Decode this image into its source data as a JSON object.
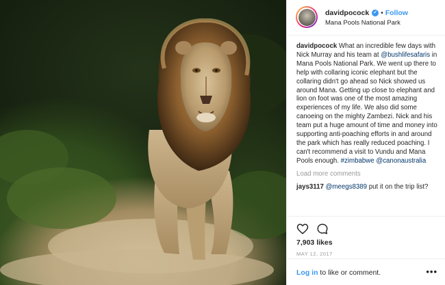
{
  "header": {
    "username": "davidpocock",
    "separator": "•",
    "follow_label": "Follow",
    "location": "Mana Pools National Park"
  },
  "caption": {
    "username": "davidpocock",
    "text_1": " What an incredible few days with Nick Murray and his team at ",
    "mention_1": "@bushlifesafaris",
    "text_2": " in Mana Pools National Park. We went up there to help with collaring iconic elephant but the collaring didn't go ahead so Nick showed us around Mana. Getting up close to elephant and lion on foot was one of the most amazing experiences of my life. We also did some canoeing on the mighty Zambezi. Nick and his team put a huge amount of time and money into supporting anti-poaching efforts in and around the park which has really reduced poaching. I can't recommend a visit to Vundu and Mana Pools enough. ",
    "hashtag": "#zimbabwe",
    "mention_2": "@canonaustralia"
  },
  "load_more_label": "Load more comments",
  "reply": {
    "username": "jays3117",
    "mention": "@meegs8389",
    "text": " put it on the trip list?"
  },
  "actions": {
    "like_icon": "heart-outline-icon",
    "comment_icon": "speech-bubble-icon",
    "likes": "7,903 likes",
    "date": "MAY 12, 2017"
  },
  "footer": {
    "login_link": "Log in",
    "login_text": " to like or comment.",
    "more_label": "•••"
  },
  "colors": {
    "link_blue": "#3897f0",
    "mention_navy": "#003569",
    "muted_gray": "#999999",
    "text_dark": "#262626",
    "verified_blue": "#3897f0"
  }
}
